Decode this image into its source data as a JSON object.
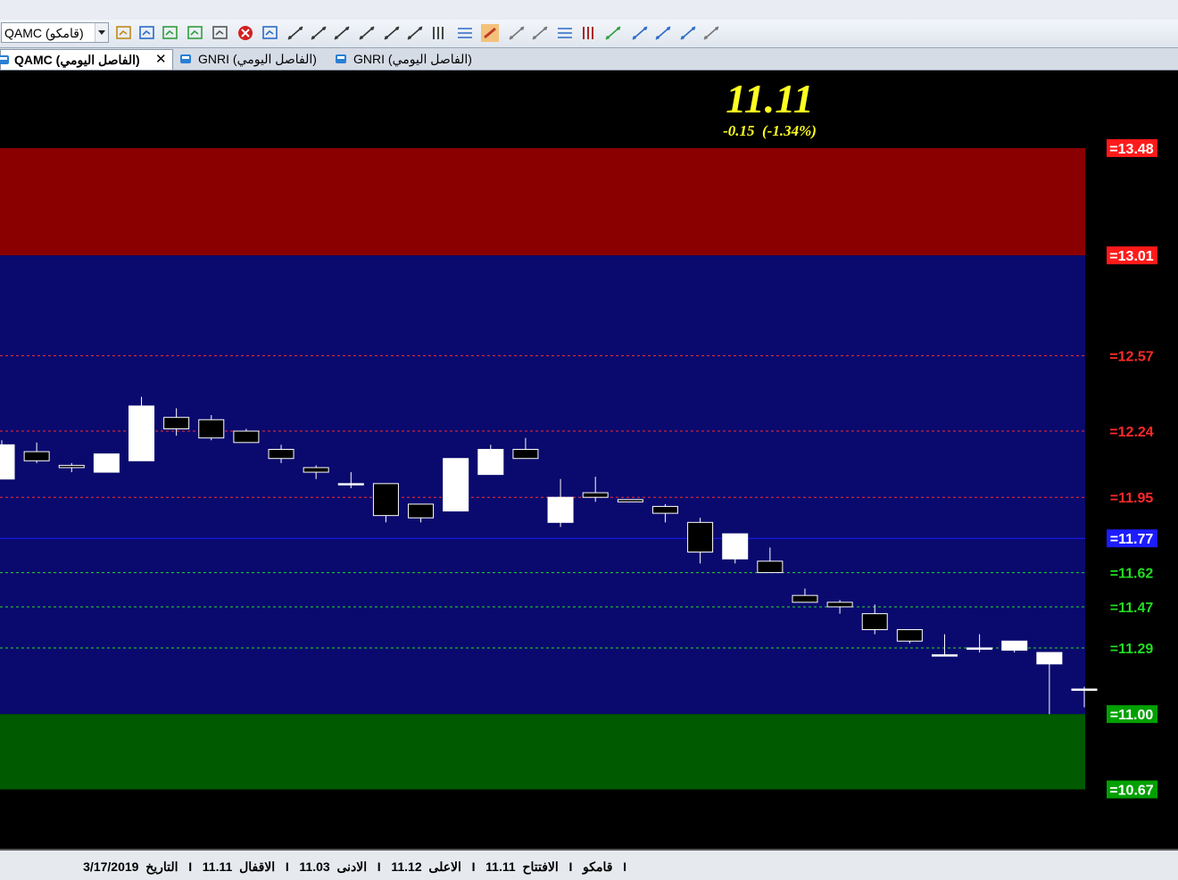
{
  "toolbar": {
    "symbol_value": "QAMC (قامكو)",
    "icons": [
      "wand-icon",
      "import-icon",
      "new-chart-icon",
      "save-chart-icon",
      "print-icon",
      "delete-icon",
      "indicator-icon",
      "trendline-icon",
      "horizontal-line-icon",
      "vertical-line-icon",
      "arrow-line-icon",
      "channel-icon",
      "parallel-lines-icon",
      "vertical-lines-icon",
      "levels-icon",
      "zones-icon",
      "circle-icon",
      "copy-icon",
      "horizontal-levels-icon",
      "bars-icon",
      "fibonacci-icon",
      "arc-icon",
      "grid-icon",
      "fan-icon",
      "text-tool-icon"
    ]
  },
  "tabs": [
    {
      "label": "QAMC (الفاصل اليومي)",
      "active": true
    },
    {
      "label": "GNRI (الفاصل اليومي)",
      "active": false
    },
    {
      "label": "GNRI (الفاصل اليومي)",
      "active": false
    }
  ],
  "quote": {
    "price": "11.11",
    "change": "-0.15  (-1.34%)"
  },
  "chart_data": {
    "type": "candlestick",
    "ylim": [
      10.41,
      13.82
    ],
    "zones": [
      {
        "from": 13.01,
        "to": 13.48,
        "color": "#8a0000"
      },
      {
        "from": 11.0,
        "to": 13.01,
        "color": "#0a0a6e"
      },
      {
        "from": 10.67,
        "to": 11.0,
        "color": "#005a00"
      }
    ],
    "levels": [
      {
        "value": 13.48,
        "label": "=13.48",
        "color": "#ff1a1a",
        "box": true,
        "line": false
      },
      {
        "value": 13.01,
        "label": "=13.01",
        "color": "#ff1a1a",
        "box": true,
        "line": false
      },
      {
        "value": 12.57,
        "label": "=12.57",
        "color": "#ff2a2a",
        "box": false,
        "line": true,
        "dash": true
      },
      {
        "value": 12.24,
        "label": "=12.24",
        "color": "#ff2a2a",
        "box": false,
        "line": true,
        "dash": true
      },
      {
        "value": 11.95,
        "label": "=11.95",
        "color": "#ff2a2a",
        "box": false,
        "line": true,
        "dash": true
      },
      {
        "value": 11.77,
        "label": "=11.77",
        "color": "#1c1cff",
        "box": true,
        "line": true,
        "dash": false
      },
      {
        "value": 11.62,
        "label": "=11.62",
        "color": "#22dd22",
        "box": false,
        "line": true,
        "dash": true
      },
      {
        "value": 11.47,
        "label": "=11.47",
        "color": "#22dd22",
        "box": false,
        "line": true,
        "dash": true
      },
      {
        "value": 11.29,
        "label": "=11.29",
        "color": "#22dd22",
        "box": false,
        "line": true,
        "dash": true
      },
      {
        "value": 11.0,
        "label": "=11.00",
        "color": "#00a000",
        "box": true,
        "line": false
      },
      {
        "value": 10.67,
        "label": "=10.67",
        "color": "#00a000",
        "box": true,
        "line": false
      }
    ],
    "candles": [
      {
        "o": 12.03,
        "h": 12.2,
        "l": 12.03,
        "c": 12.18
      },
      {
        "o": 12.15,
        "h": 12.19,
        "l": 12.1,
        "c": 12.11
      },
      {
        "o": 12.09,
        "h": 12.1,
        "l": 12.06,
        "c": 12.08
      },
      {
        "o": 12.06,
        "h": 12.14,
        "l": 12.06,
        "c": 12.14
      },
      {
        "o": 12.11,
        "h": 12.39,
        "l": 12.11,
        "c": 12.35
      },
      {
        "o": 12.3,
        "h": 12.34,
        "l": 12.22,
        "c": 12.25
      },
      {
        "o": 12.29,
        "h": 12.31,
        "l": 12.2,
        "c": 12.21
      },
      {
        "o": 12.24,
        "h": 12.25,
        "l": 12.19,
        "c": 12.19
      },
      {
        "o": 12.16,
        "h": 12.18,
        "l": 12.1,
        "c": 12.12
      },
      {
        "o": 12.08,
        "h": 12.09,
        "l": 12.03,
        "c": 12.06
      },
      {
        "o": 12.01,
        "h": 12.06,
        "l": 11.99,
        "c": 12.01
      },
      {
        "o": 12.01,
        "h": 12.01,
        "l": 11.84,
        "c": 11.87
      },
      {
        "o": 11.92,
        "h": 11.92,
        "l": 11.84,
        "c": 11.86
      },
      {
        "o": 11.89,
        "h": 12.12,
        "l": 11.89,
        "c": 12.12
      },
      {
        "o": 12.05,
        "h": 12.18,
        "l": 12.05,
        "c": 12.16
      },
      {
        "o": 12.16,
        "h": 12.21,
        "l": 12.12,
        "c": 12.12
      },
      {
        "o": 11.84,
        "h": 12.03,
        "l": 11.82,
        "c": 11.95
      },
      {
        "o": 11.97,
        "h": 12.04,
        "l": 11.93,
        "c": 11.95
      },
      {
        "o": 11.94,
        "h": 11.94,
        "l": 11.93,
        "c": 11.93
      },
      {
        "o": 11.91,
        "h": 11.92,
        "l": 11.84,
        "c": 11.88
      },
      {
        "o": 11.84,
        "h": 11.86,
        "l": 11.66,
        "c": 11.71
      },
      {
        "o": 11.68,
        "h": 11.79,
        "l": 11.66,
        "c": 11.79
      },
      {
        "o": 11.67,
        "h": 11.73,
        "l": 11.62,
        "c": 11.62
      },
      {
        "o": 11.52,
        "h": 11.55,
        "l": 11.49,
        "c": 11.49
      },
      {
        "o": 11.49,
        "h": 11.5,
        "l": 11.44,
        "c": 11.47
      },
      {
        "o": 11.44,
        "h": 11.48,
        "l": 11.35,
        "c": 11.37
      },
      {
        "o": 11.37,
        "h": 11.37,
        "l": 11.31,
        "c": 11.32
      },
      {
        "o": 11.26,
        "h": 11.35,
        "l": 11.26,
        "c": 11.26
      },
      {
        "o": 11.29,
        "h": 11.35,
        "l": 11.27,
        "c": 11.29
      },
      {
        "o": 11.28,
        "h": 11.32,
        "l": 11.27,
        "c": 11.32
      },
      {
        "o": 11.22,
        "h": 11.27,
        "l": 11.0,
        "c": 11.27
      },
      {
        "o": 11.11,
        "h": 11.12,
        "l": 11.03,
        "c": 11.11
      }
    ]
  },
  "status": {
    "text": "I   قامكو   I   الافتتاح  11.11   I   الاعلى  11.12   I   الادنى  11.03   I   الاقفال  11.11   I   التاريخ  3/17/2019"
  }
}
